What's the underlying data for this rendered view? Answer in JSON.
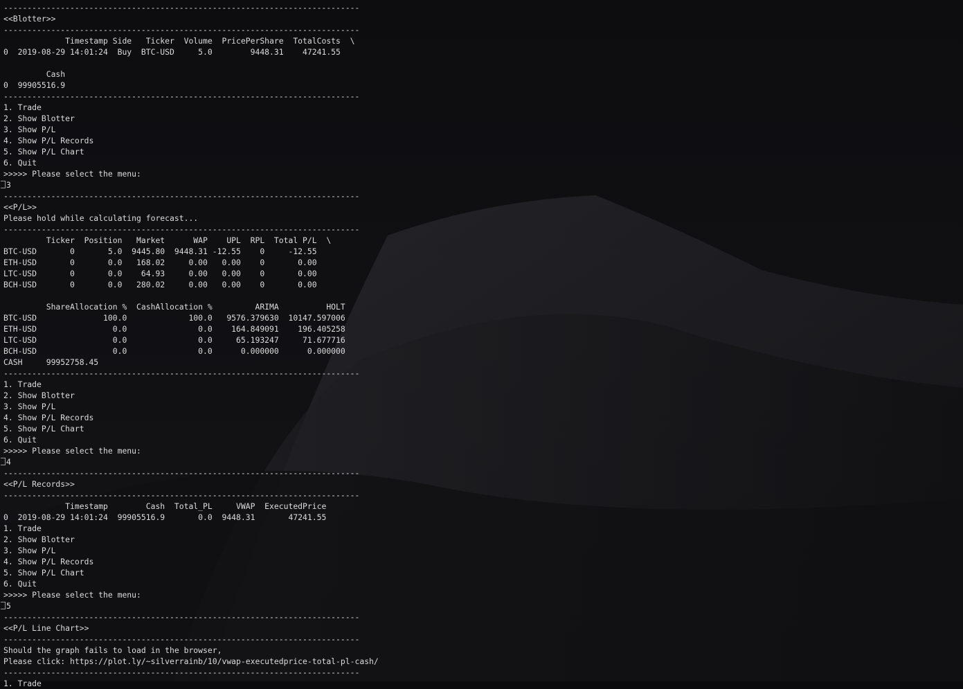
{
  "terminal": {
    "lines": [
      {
        "text": "---------------------------------------------------------------------------"
      },
      {
        "text": "<<Blotter>>"
      },
      {
        "text": "---------------------------------------------------------------------------"
      },
      {
        "text": "             Timestamp Side   Ticker  Volume  PricePerShare  TotalCosts  \\"
      },
      {
        "text": "0  2019-08-29 14:01:24  Buy  BTC-USD     5.0        9448.31    47241.55"
      },
      {
        "text": ""
      },
      {
        "text": "         Cash"
      },
      {
        "text": "0  99905516.9"
      },
      {
        "text": "---------------------------------------------------------------------------"
      },
      {
        "text": "1. Trade"
      },
      {
        "text": "2. Show Blotter"
      },
      {
        "text": "3. Show P/L"
      },
      {
        "text": "4. Show P/L Records"
      },
      {
        "text": "5. Show P/L Chart"
      },
      {
        "text": "6. Quit"
      },
      {
        "text": ">>>>> Please select the menu:"
      },
      {
        "text": "3",
        "input": true
      },
      {
        "text": "---------------------------------------------------------------------------"
      },
      {
        "text": "<<P/L>>"
      },
      {
        "text": "Please hold while calculating forecast..."
      },
      {
        "text": "---------------------------------------------------------------------------"
      },
      {
        "text": "         Ticker  Position   Market      WAP    UPL  RPL  Total P/L  \\"
      },
      {
        "text": "BTC-USD       0       5.0  9445.80  9448.31 -12.55    0     -12.55"
      },
      {
        "text": "ETH-USD       0       0.0   168.02     0.00   0.00    0       0.00"
      },
      {
        "text": "LTC-USD       0       0.0    64.93     0.00   0.00    0       0.00"
      },
      {
        "text": "BCH-USD       0       0.0   280.02     0.00   0.00    0       0.00"
      },
      {
        "text": ""
      },
      {
        "text": "         ShareAllocation %  CashAllocation %         ARIMA          HOLT"
      },
      {
        "text": "BTC-USD              100.0             100.0   9576.379630  10147.597006"
      },
      {
        "text": "ETH-USD                0.0               0.0    164.849091    196.405258"
      },
      {
        "text": "LTC-USD                0.0               0.0     65.193247     71.677716"
      },
      {
        "text": "BCH-USD                0.0               0.0      0.000000      0.000000"
      },
      {
        "text": "CASH     99952758.45"
      },
      {
        "text": "---------------------------------------------------------------------------"
      },
      {
        "text": "1. Trade"
      },
      {
        "text": "2. Show Blotter"
      },
      {
        "text": "3. Show P/L"
      },
      {
        "text": "4. Show P/L Records"
      },
      {
        "text": "5. Show P/L Chart"
      },
      {
        "text": "6. Quit"
      },
      {
        "text": ">>>>> Please select the menu:"
      },
      {
        "text": "4",
        "input": true
      },
      {
        "text": "---------------------------------------------------------------------------"
      },
      {
        "text": "<<P/L Records>>"
      },
      {
        "text": "---------------------------------------------------------------------------"
      },
      {
        "text": "             Timestamp        Cash  Total_PL     VWAP  ExecutedPrice"
      },
      {
        "text": "0  2019-08-29 14:01:24  99905516.9       0.0  9448.31       47241.55"
      },
      {
        "text": "1. Trade"
      },
      {
        "text": "2. Show Blotter"
      },
      {
        "text": "3. Show P/L"
      },
      {
        "text": "4. Show P/L Records"
      },
      {
        "text": "5. Show P/L Chart"
      },
      {
        "text": "6. Quit"
      },
      {
        "text": ">>>>> Please select the menu:"
      },
      {
        "text": "5",
        "input": true
      },
      {
        "text": "---------------------------------------------------------------------------"
      },
      {
        "text": "<<P/L Line Chart>>"
      },
      {
        "text": "---------------------------------------------------------------------------"
      },
      {
        "text": "Should the graph fails to load in the browser,"
      },
      {
        "text": "Please click: https://plot.ly/~silverrainb/10/vwap-executedprice-total-pl-cash/"
      },
      {
        "text": "---------------------------------------------------------------------------"
      },
      {
        "text": "1. Trade"
      }
    ]
  },
  "colors": {
    "background": "#0b0b0d",
    "text": "#dcdcdc",
    "dune": "#2a2a2e"
  }
}
